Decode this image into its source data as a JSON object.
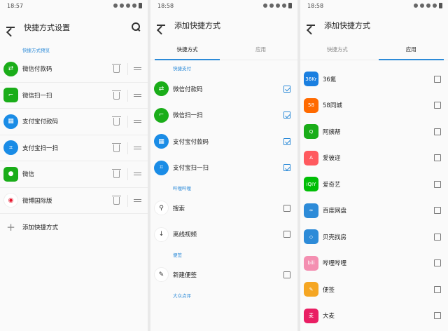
{
  "status": {
    "time1": "18:57",
    "time2": "18:58",
    "time3": "18:58"
  },
  "screen1": {
    "title": "快捷方式设置",
    "section": "快捷方式预览",
    "items": [
      {
        "label": "微信付款码",
        "icon": "wechat-pay-icon",
        "color": "#1aad19"
      },
      {
        "label": "微信扫一扫",
        "icon": "wechat-scan-icon",
        "color": "#1aad19"
      },
      {
        "label": "支付宝付款码",
        "icon": "alipay-pay-icon",
        "color": "#1a8ce6"
      },
      {
        "label": "支付宝扫一扫",
        "icon": "alipay-scan-icon",
        "color": "#1a8ce6"
      },
      {
        "label": "微信",
        "icon": "wechat-icon",
        "color": "#1aad19"
      },
      {
        "label": "微博国际版",
        "icon": "weibo-icon",
        "color": "#e6162d"
      }
    ],
    "add_label": "添加快捷方式"
  },
  "screen2": {
    "title": "添加快捷方式",
    "tabs": [
      "快捷方式",
      "应用"
    ],
    "groups": [
      {
        "name": "快捷支付",
        "items": [
          {
            "label": "微信付款码",
            "checked": true
          },
          {
            "label": "微信扫一扫",
            "checked": true
          },
          {
            "label": "支付宝付款码",
            "checked": true
          },
          {
            "label": "支付宝扫一扫",
            "checked": true
          }
        ]
      },
      {
        "name": "哔哩哔哩",
        "items": [
          {
            "label": "搜索",
            "checked": false
          },
          {
            "label": "离线视频",
            "checked": false
          }
        ]
      },
      {
        "name": "便签",
        "items": [
          {
            "label": "新建便签",
            "checked": false
          }
        ]
      },
      {
        "name": "大众点评",
        "items": []
      }
    ]
  },
  "screen3": {
    "title": "添加快捷方式",
    "tabs": [
      "快捷方式",
      "应用"
    ],
    "apps": [
      {
        "label": "36氪",
        "icon_text": "36Kr",
        "color": "#1a7fe0"
      },
      {
        "label": "58同城",
        "icon_text": "58",
        "color": "#ff6a00"
      },
      {
        "label": "阿姨帮",
        "icon_text": "Q",
        "color": "#1aad19"
      },
      {
        "label": "爱彼迎",
        "icon_text": "A",
        "color": "#ff5a5f"
      },
      {
        "label": "爱奇艺",
        "icon_text": "iQIY",
        "color": "#00be06"
      },
      {
        "label": "百度网盘",
        "icon_text": "∞",
        "color": "#2d8bd8"
      },
      {
        "label": "贝壳找房",
        "icon_text": "◇",
        "color": "#2d8bd8"
      },
      {
        "label": "哔哩哔哩",
        "icon_text": "bili",
        "color": "#f48fb1"
      },
      {
        "label": "便签",
        "icon_text": "✎",
        "color": "#f5a623"
      },
      {
        "label": "大麦",
        "icon_text": "麦",
        "color": "#e91e63"
      }
    ]
  }
}
